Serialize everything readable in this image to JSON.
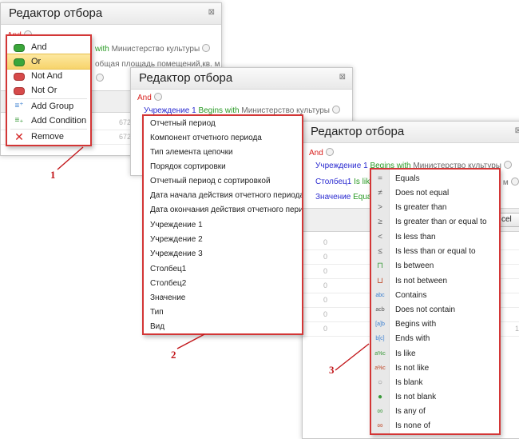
{
  "windows": {
    "w1": {
      "title": "Редактор отбора",
      "close_symbol": "⊠",
      "root_op": "And",
      "row1_tail": "with",
      "row1_value": "Министерство культуры",
      "row2_value": "общая площадь помещений,кв. м",
      "grid_values": [
        "672",
        "672"
      ]
    },
    "w2": {
      "title": "Редактор отбора",
      "close_symbol": "⊠",
      "root_op": "And",
      "cond_field": "Учреждение 1",
      "cond_op": "Begins with",
      "cond_value": "Министерство культуры"
    },
    "w3": {
      "title": "Редактор отбора",
      "close_symbol": "⊠",
      "root_op": "And",
      "cond1_field": "Учреждение 1",
      "cond1_op": "Begins with",
      "cond1_value": "Министерство культуры",
      "cond2_field": "Столбец1",
      "cond2_op_partial": "Is lik",
      "cond2_tail": "в, м",
      "cond3_field": "Значение",
      "cond3_op_partial": "Equa",
      "cancel_partial": "cel",
      "grid_zeros": [
        "0",
        "0",
        "0",
        "0",
        "0",
        "0",
        "0"
      ],
      "grid_right_value": "1"
    }
  },
  "group_menu": {
    "items": [
      {
        "label": "And",
        "icon": "and-icon"
      },
      {
        "label": "Or",
        "icon": "or-icon"
      },
      {
        "label": "Not And",
        "icon": "not-and-icon"
      },
      {
        "label": "Not Or",
        "icon": "not-or-icon"
      },
      {
        "label": "Add Group",
        "icon": "add-group-icon"
      },
      {
        "label": "Add Condition",
        "icon": "add-condition-icon"
      },
      {
        "label": "Remove",
        "icon": "remove-icon"
      }
    ],
    "colors": {
      "green": "#3aa63a",
      "red": "#d64a4a",
      "highlight": "#f7d46c"
    }
  },
  "field_list": {
    "items": [
      "Отчетный период",
      "Компонент отчетного периода",
      "Тип элемента цепочки",
      "Порядок сортировки",
      "Отчетный период с сортировкой",
      "Дата начала действия отчетного периода",
      "Дата окончания действия отчетного перио",
      "Учреждение 1",
      "Учреждение 2",
      "Учреждение 3",
      "Столбец1",
      "Столбец2",
      "Значение",
      "Тип",
      "Вид"
    ]
  },
  "operator_list": {
    "items": [
      {
        "label": "Equals",
        "glyph": "="
      },
      {
        "label": "Does not equal",
        "glyph": "≠"
      },
      {
        "label": "Is greater than",
        "glyph": ">"
      },
      {
        "label": "Is greater than or equal to",
        "glyph": "≥"
      },
      {
        "label": "Is less than",
        "glyph": "<"
      },
      {
        "label": "Is less than or equal to",
        "glyph": "≤"
      },
      {
        "label": "Is between",
        "glyph": "⊓"
      },
      {
        "label": "Is not between",
        "glyph": "⊔"
      },
      {
        "label": "Contains",
        "glyph": "abc"
      },
      {
        "label": "Does not contain",
        "glyph": "acb"
      },
      {
        "label": "Begins with",
        "glyph": "[a]b"
      },
      {
        "label": "Ends with",
        "glyph": "b[c]"
      },
      {
        "label": "Is like",
        "glyph": "a%c"
      },
      {
        "label": "Is not like",
        "glyph": "a%c"
      },
      {
        "label": "Is blank",
        "glyph": "○"
      },
      {
        "label": "Is not blank",
        "glyph": "●"
      },
      {
        "label": "Is any of",
        "glyph": "∞"
      },
      {
        "label": "Is none of",
        "glyph": "∞"
      }
    ]
  },
  "callouts": {
    "one": "1",
    "two": "2",
    "three": "3"
  },
  "colors": {
    "callout_border": "#d33636",
    "field_blue": "#2a2ad0",
    "op_green": "#2a9a25",
    "group_red": "#d8211e"
  }
}
